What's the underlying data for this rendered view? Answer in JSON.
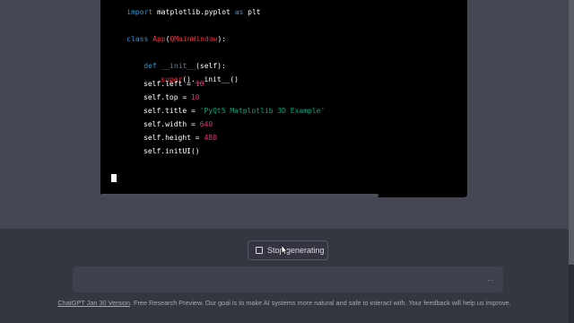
{
  "code": {
    "lines": [
      "import matplotlib.pyplot as plt",
      "class App(QMainWindow):",
      "def __init__(self):",
      "super().__init__()",
      "self.left = 10",
      "self.top = 10",
      "self.title = 'PyQt5 Matplotlib 3D Example'",
      "self.width = 640",
      "self.height = 480",
      "self.initUI()"
    ]
  },
  "controls": {
    "stop_label": "Stop generating",
    "input_placeholder": "",
    "input_indicator": ".."
  },
  "footer": {
    "version_link": "ChatGPT Jan 30 Version",
    "text": ". Free Research Preview. Our goal is to make AI systems more natural and safe to interact with. Your feedback will help us improve."
  },
  "colors": {
    "background": "#444654",
    "lower_panel": "#353740",
    "code_background": "#000000",
    "keyword": "#2e95d3",
    "class_name": "#f22c3d",
    "number": "#df3079",
    "string": "#00a67d"
  }
}
